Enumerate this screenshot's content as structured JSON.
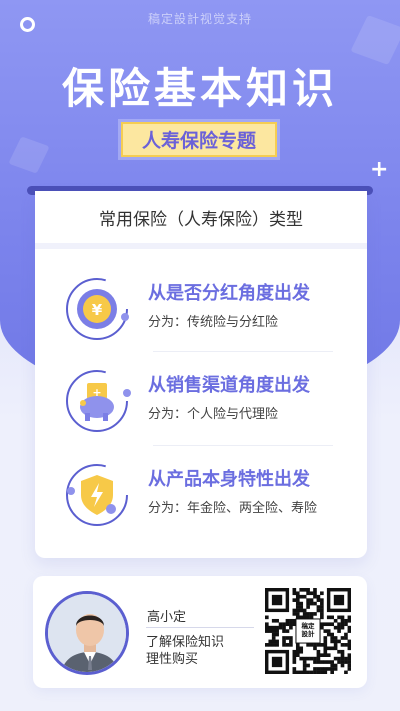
{
  "header": {
    "brand_text": "稿定設計视觉支持",
    "title": "保险基本知识",
    "subtitle": "人寿保险专题"
  },
  "card": {
    "heading": "常用保险（人寿保险）类型",
    "items": [
      {
        "icon": "yuan-coin-icon",
        "heading": "从是否分红角度出发",
        "desc": "分为：传统险与分红险"
      },
      {
        "icon": "piggy-bank-icon",
        "heading": "从销售渠道角度出发",
        "desc": "分为：个人险与代理险"
      },
      {
        "icon": "shield-lightning-icon",
        "heading": "从产品本身特性出发",
        "desc": "分为：年金险、两全险、寿险"
      }
    ]
  },
  "profile": {
    "name": "高小定",
    "tagline_1": "了解保险知识",
    "tagline_2": "理性购买",
    "qr_center_text": "稿定\n設計"
  },
  "colors": {
    "accent": "#6b6ee0",
    "dark_accent": "#4b50b8",
    "highlight": "#fce7a0"
  }
}
